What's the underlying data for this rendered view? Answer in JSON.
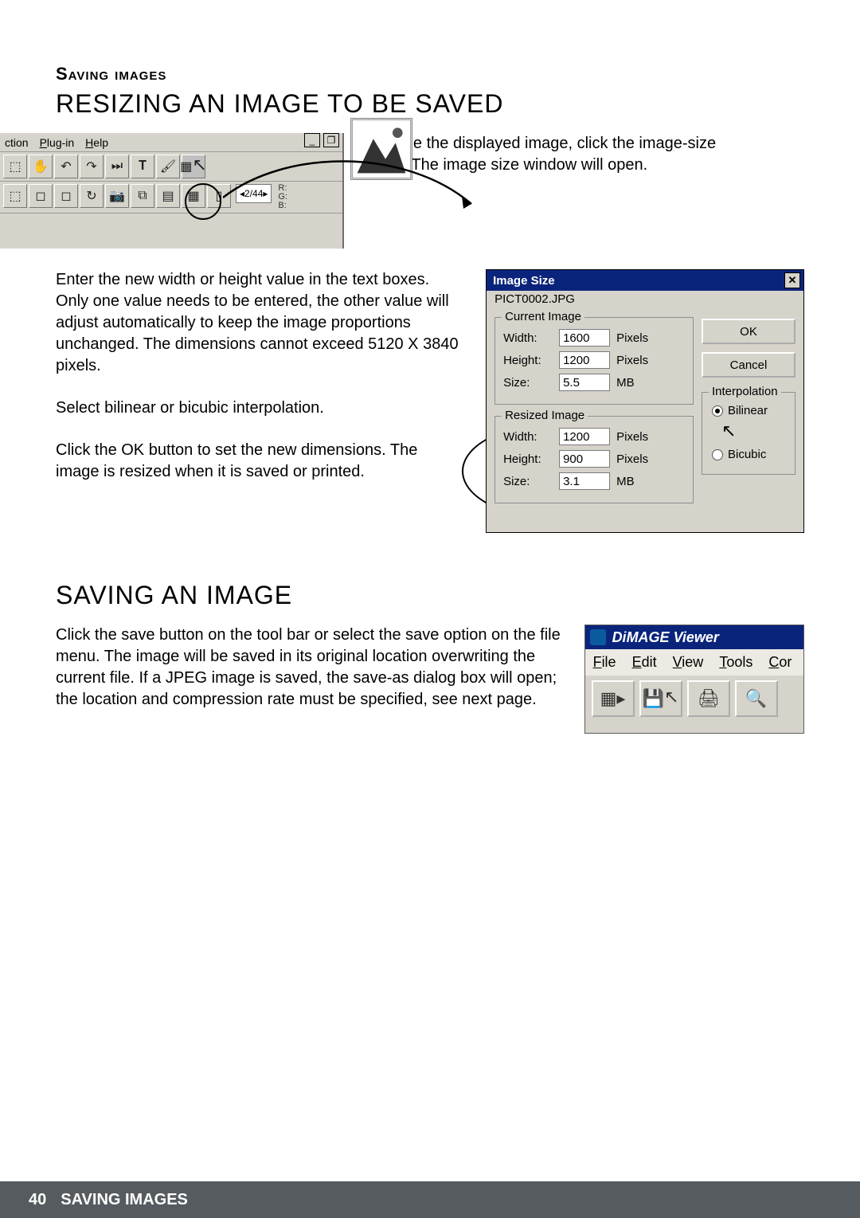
{
  "header": {
    "section": "Saving images",
    "title": "RESIZING AN IMAGE TO BE SAVED"
  },
  "intro": "To resize the displayed image, click the image-size button. The image size window will open.",
  "menubar": {
    "items": [
      "ction",
      "Plug-in",
      "Help"
    ]
  },
  "navcount": "2/44",
  "rgb": {
    "r": "R:",
    "g": "G:",
    "b": "B:"
  },
  "instructions": {
    "p1": "Enter the new width or height value in the text boxes. Only one value needs to be entered, the other value will adjust automatically to keep the image proportions unchanged. The dimensions cannot exceed 5120 X 3840 pixels.",
    "p2": "Select bilinear or bicubic interpolation.",
    "p3": "Click the OK button to set the new dimensions. The image is resized when it is saved or printed."
  },
  "dialog": {
    "title": "Image Size",
    "filename": "PICT0002.JPG",
    "buttons": {
      "ok": "OK",
      "cancel": "Cancel"
    },
    "interpolation": {
      "legend": "Interpolation",
      "bilinear": "Bilinear",
      "bicubic": "Bicubic",
      "selected": "bilinear"
    },
    "current": {
      "legend": "Current Image",
      "width_label": "Width:",
      "width": "1600",
      "width_unit": "Pixels",
      "height_label": "Height:",
      "height": "1200",
      "height_unit": "Pixels",
      "size_label": "Size:",
      "size": "5.5",
      "size_unit": "MB"
    },
    "resized": {
      "legend": "Resized Image",
      "width_label": "Width:",
      "width": "1200",
      "width_unit": "Pixels",
      "height_label": "Height:",
      "height": "900",
      "height_unit": "Pixels",
      "size_label": "Size:",
      "size": "3.1",
      "size_unit": "MB"
    }
  },
  "section2": {
    "title": "SAVING AN IMAGE",
    "body": "Click the save button on the tool bar or select the save option on the file menu. The image will be saved in its original location overwriting the current file. If a JPEG image is saved, the save-as dialog box will open; the location and compression rate must be specified, see next page."
  },
  "viewer": {
    "appname": "DiMAGE Viewer",
    "menus": [
      "File",
      "Edit",
      "View",
      "Tools",
      "Cor"
    ]
  },
  "footer": {
    "page": "40",
    "label": "SAVING IMAGES"
  }
}
